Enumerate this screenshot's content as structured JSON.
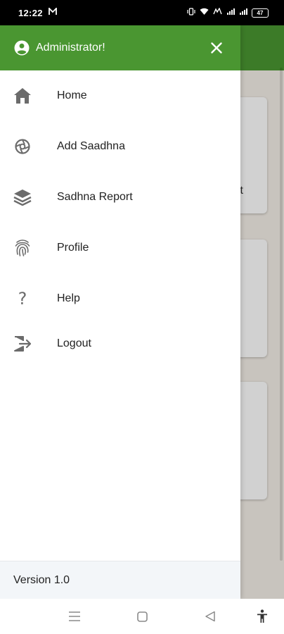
{
  "status_bar": {
    "time": "12:22",
    "notification_icon": "m-icon",
    "battery": "47"
  },
  "drawer": {
    "header": {
      "title": "Administrator!",
      "avatar_icon": "account-circle-icon",
      "close_icon": "close-icon"
    },
    "items": [
      {
        "label": "Home",
        "icon": "home-icon"
      },
      {
        "label": "Add Saadhna",
        "icon": "aperture-icon"
      },
      {
        "label": "Sadhna Report",
        "icon": "layers-icon"
      },
      {
        "label": "Profile",
        "icon": "fingerprint-icon"
      },
      {
        "label": "Help",
        "icon": "question-icon"
      },
      {
        "label": "Logout",
        "icon": "logout-icon"
      }
    ],
    "footer": {
      "version": "Version 1.0"
    }
  },
  "background": {
    "card_text": "t"
  },
  "colors": {
    "primary": "#4a9631",
    "drawer_bg": "#ffffff",
    "footer_bg": "#f3f6f9",
    "icon": "#6b6b6b"
  },
  "nav_bar": {
    "buttons": [
      "menu-icon",
      "home-square-icon",
      "back-icon",
      "accessibility-icon"
    ]
  }
}
